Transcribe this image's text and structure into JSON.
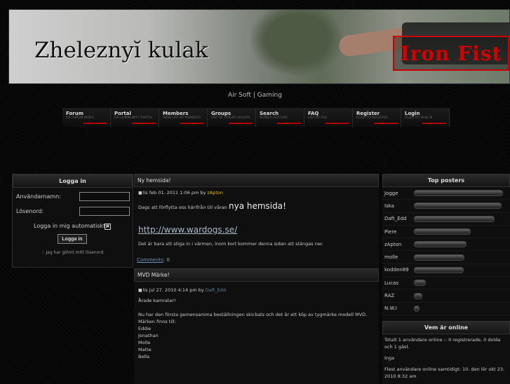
{
  "banner": {
    "site_title": "Zheleznyĭ kulak",
    "brand": "Iron Fist"
  },
  "tagline": "Air Soft | Gaming",
  "nav": [
    {
      "title": "Forum",
      "sub": "GÅ FORUM INDEX"
    },
    {
      "title": "Portal",
      "sub": "GÅ COMMUNITY PORTAL"
    },
    {
      "title": "Members",
      "sub": "VIEW LIST OF MEMBERS"
    },
    {
      "title": "Groups",
      "sub": "LIST OF FORUM GROUPS"
    },
    {
      "title": "Search",
      "sub": "SEARCH FEATURE"
    },
    {
      "title": "FAQ",
      "sub": "LIST OF FAQ"
    },
    {
      "title": "Register",
      "sub": "CLICK TO REGISTER"
    },
    {
      "title": "Login",
      "sub": "CLICK TO SIGN IN"
    }
  ],
  "login": {
    "heading": "Logga in",
    "username_label": "Användarnamn:",
    "password_label": "Lösenord:",
    "remember_label": "Logga in mig automatiskt:",
    "remember_check": "✖",
    "button": "Logga in",
    "forgot": ":: Jag har glömt mitt lösenord"
  },
  "posts": [
    {
      "title": "Ny hemsida!",
      "date": "lis feb 01. 2011 1:06 pm by",
      "author": "zApton",
      "text1": "Dags att förflytta oss härifrån till våran",
      "highlight": "nya hemsida!",
      "url": "http://www.wardogs.se/",
      "text2": "Det är bara att stiga in i värmen, inom kort kommer denna sidan att stängas ner.",
      "comments_label": "Comments",
      "comments_count": ": 0"
    },
    {
      "title": "MVD Märke!",
      "date": "lis jul 27. 2010 4:14 pm by",
      "author": "Daft_Edd",
      "lines": [
        "Årade kamrater!",
        "",
        "Nu har den första gemensamma beställningen skickats och det är ett köp av tygmärke modell MVD.",
        "Märken finns till:",
        "Eddie",
        "Jonathan",
        "Molle",
        "Matte",
        "Bella"
      ]
    }
  ],
  "top_posters": {
    "heading": "Top posters",
    "rows": [
      {
        "name": "Jogge",
        "fraction": 1.0
      },
      {
        "name": "Iska",
        "fraction": 0.98
      },
      {
        "name": "Daft_Edd",
        "fraction": 0.9
      },
      {
        "name": "Piere",
        "fraction": 0.63
      },
      {
        "name": "zApton",
        "fraction": 0.58
      },
      {
        "name": "molle",
        "fraction": 0.56
      },
      {
        "name": "kodden89",
        "fraction": 0.55
      },
      {
        "name": "Lucas",
        "fraction": 0.12
      },
      {
        "name": "RAZ",
        "fraction": 0.08
      },
      {
        "name": "N.W.I",
        "fraction": 0.04
      }
    ]
  },
  "online": {
    "heading": "Vem är online",
    "line1": "Totalt 1 användare online :: 0 registrerade, 0 dolda och 1 gäst.",
    "line2": "Inga",
    "line3": "Flest användare online samtidigt: 10. den lör okt 23. 2010 8:32 am"
  }
}
